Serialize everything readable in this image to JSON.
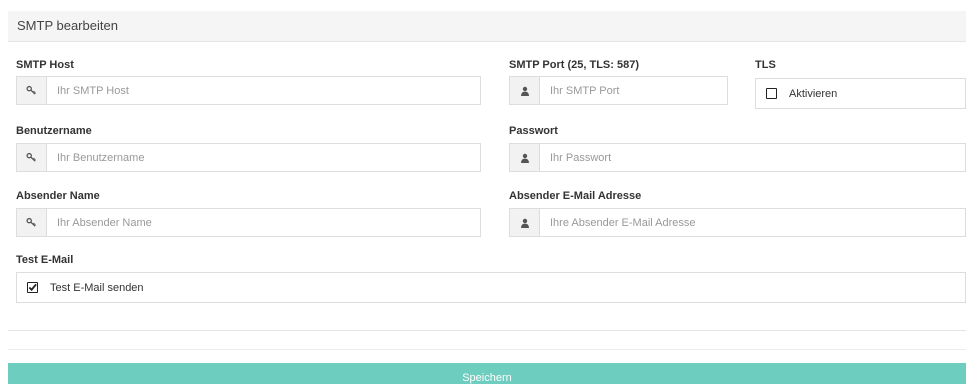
{
  "panel": {
    "title": "SMTP bearbeiten"
  },
  "smtp_host": {
    "label": "SMTP Host",
    "placeholder": "Ihr SMTP Host",
    "icon": "key-icon"
  },
  "smtp_port": {
    "label": "SMTP Port (25, TLS: 587)",
    "placeholder": "Ihr SMTP Port",
    "icon": "user-icon"
  },
  "tls": {
    "label": "TLS",
    "checkbox_label": "Aktivieren",
    "checked": false
  },
  "username": {
    "label": "Benutzername",
    "placeholder": "Ihr Benutzername",
    "icon": "key-icon"
  },
  "password": {
    "label": "Passwort",
    "placeholder": "Ihr Passwort",
    "icon": "user-icon"
  },
  "sender_name": {
    "label": "Absender Name",
    "placeholder": "Ihr Absender Name",
    "icon": "key-icon"
  },
  "sender_email": {
    "label": "Absender E-Mail Adresse",
    "placeholder": "Ihre Absender E-Mail Adresse",
    "icon": "user-icon"
  },
  "test_email": {
    "label": "Test E-Mail",
    "checkbox_label": "Test E-Mail senden",
    "checked": true
  },
  "actions": {
    "save_label": "Speichern",
    "save_color": "#6dcdbf"
  }
}
